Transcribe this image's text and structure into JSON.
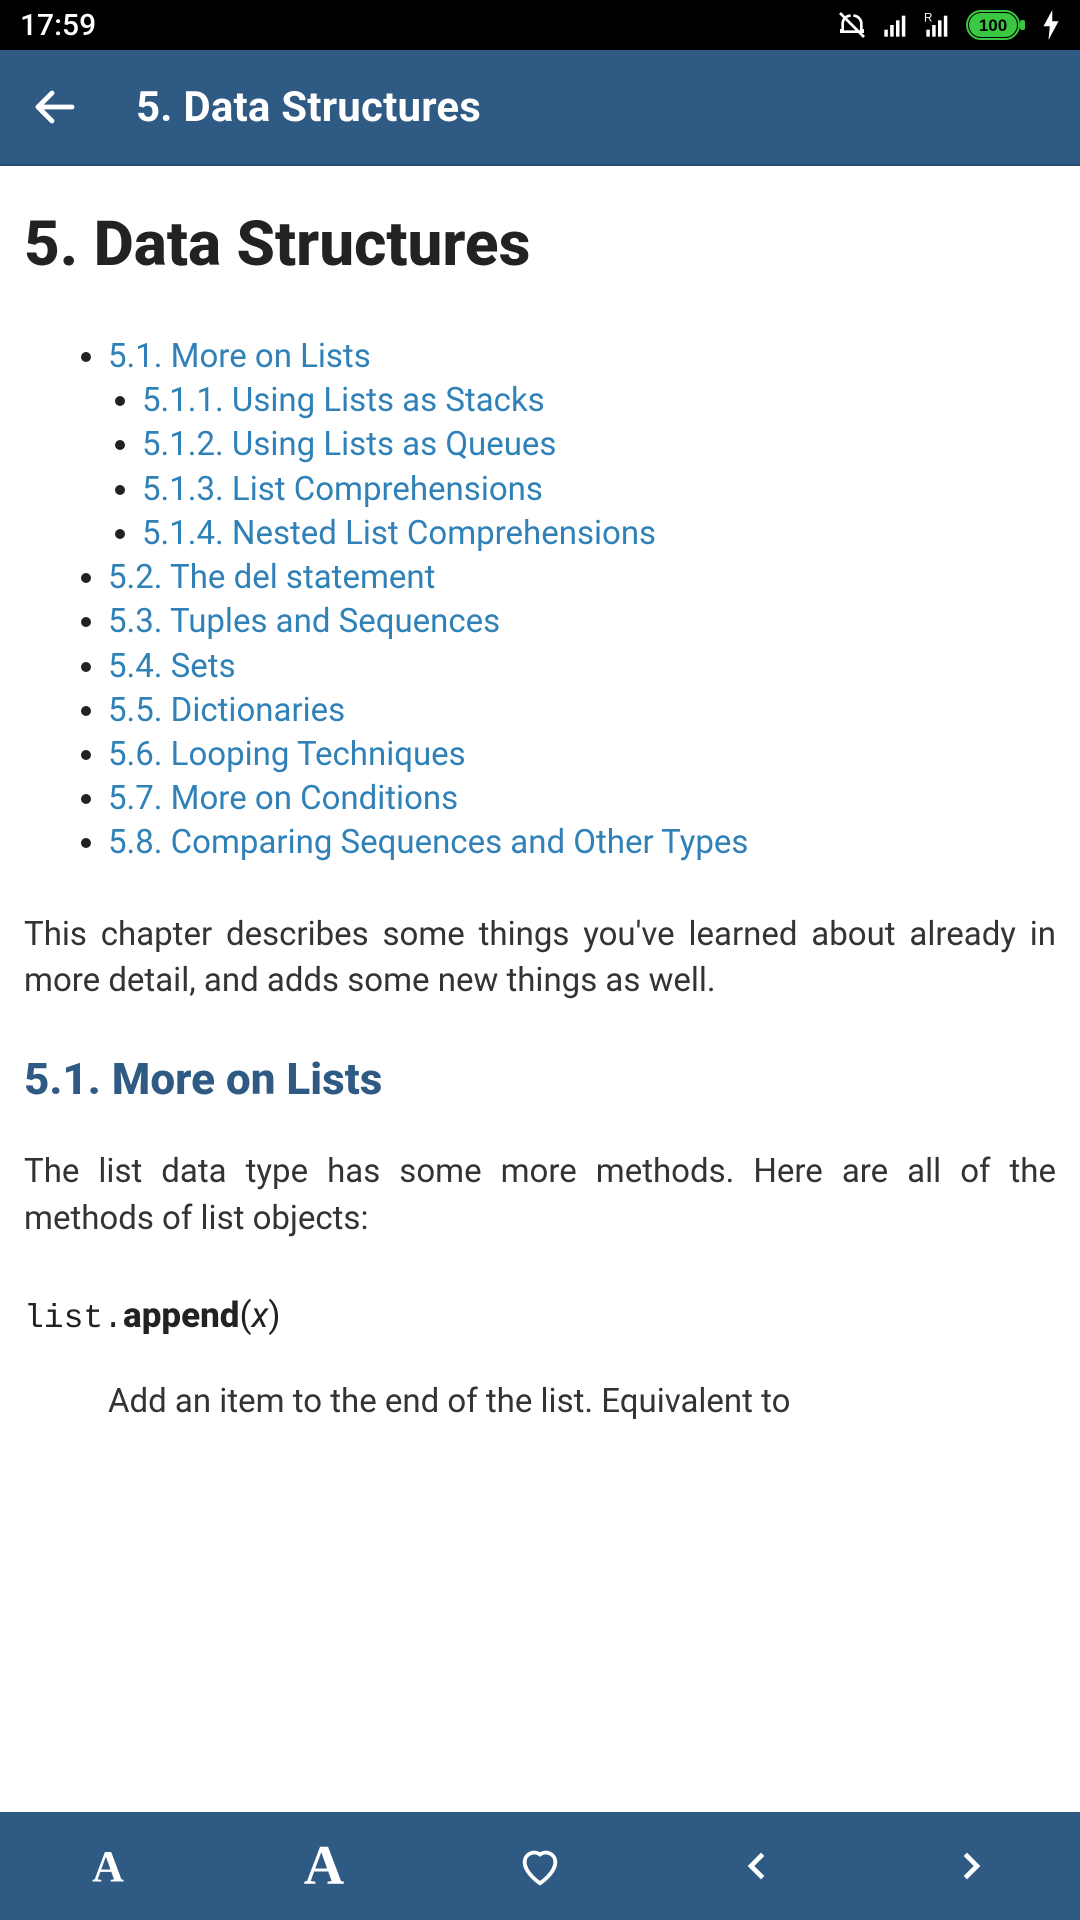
{
  "status": {
    "time": "17:59",
    "battery": "100"
  },
  "appbar": {
    "title": "5. Data Structures"
  },
  "page": {
    "h1": "5. Data Structures",
    "toc": {
      "s1": "5.1. More on Lists",
      "s1_1": "5.1.1. Using Lists as Stacks",
      "s1_2": "5.1.2. Using Lists as Queues",
      "s1_3": "5.1.3. List Comprehensions",
      "s1_4": "5.1.4. Nested List Comprehensions",
      "s2": "5.2. The del statement",
      "s3": "5.3. Tuples and Sequences",
      "s4": "5.4. Sets",
      "s5": "5.5. Dictionaries",
      "s6": "5.6. Looping Techniques",
      "s7": "5.7. More on Conditions",
      "s8": "5.8. Comparing Sequences and Other Types"
    },
    "intro": "This chapter describes some things you've learned about already in more detail, and adds some new things as well.",
    "h2": "5.1. More on Lists",
    "p2": "The list data type has some more methods. Here are all of the methods of list objects:",
    "method": {
      "cls": "list.",
      "name": "append",
      "open": "(",
      "arg": "x",
      "close": ")"
    },
    "desc": "Add an item to the end of the list. Equivalent to"
  }
}
